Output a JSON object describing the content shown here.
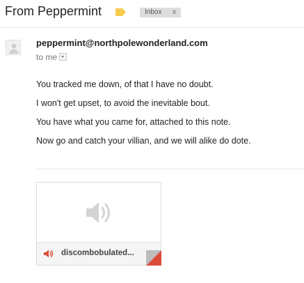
{
  "header": {
    "subject": "From Peppermint",
    "label_color": "#f7cb4d",
    "inbox_chip": {
      "label": "Inbox",
      "remove": "x"
    }
  },
  "message": {
    "sender_email": "peppermint@northpolewonderland.com",
    "recipient": "to me",
    "body_lines": [
      "You tracked me down, of that I have no doubt.",
      "I won't get upset, to avoid the inevitable bout.",
      "You have what you came for, attached to this note.",
      "Now go and catch your villian, and we will alike do dote."
    ]
  },
  "attachment": {
    "filename": "discombobulated...",
    "icon": "audio-speaker-icon",
    "accent_color": "#dd4b39"
  }
}
